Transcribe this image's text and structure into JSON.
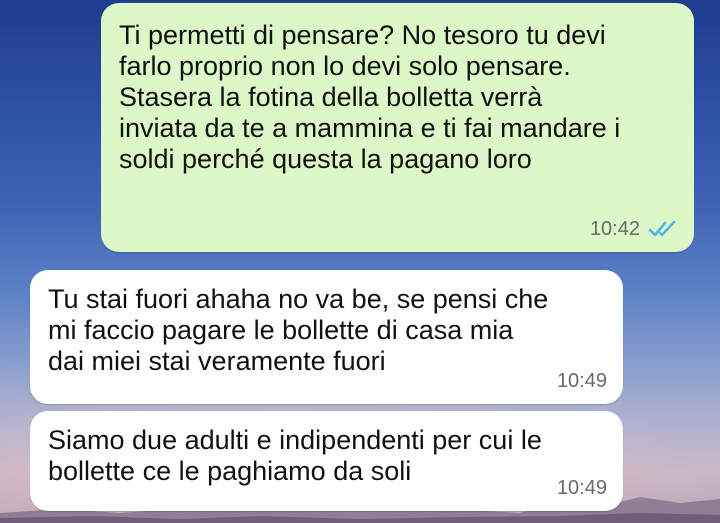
{
  "colors": {
    "outgoing_bubble": "#dcf8c6",
    "incoming_bubble": "#ffffff",
    "read_ticks": "#4fb6ec"
  },
  "messages": [
    {
      "direction": "outgoing",
      "text": "Ti permetti di pensare? No tesoro tu devi\nfarlo proprio non lo devi solo pensare.\nStasera la fotina della bolletta verrà\ninviata da te a mammina e ti fai mandare i\nsoldi perché questa la pagano loro",
      "time": "10:42",
      "status_icon": "double-check-read-icon"
    },
    {
      "direction": "incoming",
      "text": "Tu stai fuori ahaha no va be, se pensi che\nmi faccio pagare le bollette di casa mia\ndai miei stai veramente fuori",
      "time": "10:49"
    },
    {
      "direction": "incoming",
      "text": "Siamo due adulti e indipendenti per cui le\nbollette ce le paghiamo da soli",
      "time": "10:49"
    }
  ]
}
